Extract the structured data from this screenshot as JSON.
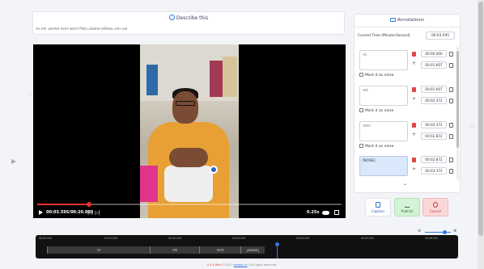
{
  "describe": {
    "title": "Describe this",
    "text": "সব তথ্য একসাথে সমস্যা কারণে শিরায় প্রোগ্রামে ফাউন্ডার সেবা দেবা"
  },
  "video": {
    "time": "00:03.595/00:20.985",
    "speed": "0.25x",
    "progress_fraction": 0.17
  },
  "annotations": {
    "title": "Annotations",
    "current_time_label": "Current Time (Minute:Second)",
    "current_time_value": "00:03.595",
    "mark_noise_label": "Mark it as noise",
    "segments": [
      {
        "text": "সব",
        "start": "00:00.000",
        "end": "00:01.607"
      },
      {
        "text": "তথ্য",
        "start": "00:01.607",
        "end": "00:02.372"
      },
      {
        "text": "সমস্যা",
        "start": "00:02.372",
        "end": "00:02.872"
      },
      {
        "text": "[NOISE]",
        "start": "00:02.872",
        "end": "00:03.372"
      }
    ]
  },
  "buttons": {
    "caption": "Caption",
    "publish": "Publish",
    "cancel": "Cancel"
  },
  "timeline": {
    "ticks": [
      "00:00.000",
      "00:01.000",
      "00:02.000",
      "00:03.000",
      "00:04.000",
      "00:05.000",
      "00:06.000"
    ],
    "segments": [
      "সব",
      "তথ্য",
      "সমস্যা",
      "[NOISE]"
    ]
  },
  "footer": {
    "version": "0.5.4 Beta",
    "copyright": "©2021",
    "brand": "bengali.ai",
    "rights": "All rights reserved."
  },
  "colors": {
    "accent": "#2f78e0",
    "progress": "#e5312f",
    "publish_bg": "#d4f2d6",
    "cancel_bg": "#fad8d8",
    "noise_bg": "#d9e8fb"
  }
}
